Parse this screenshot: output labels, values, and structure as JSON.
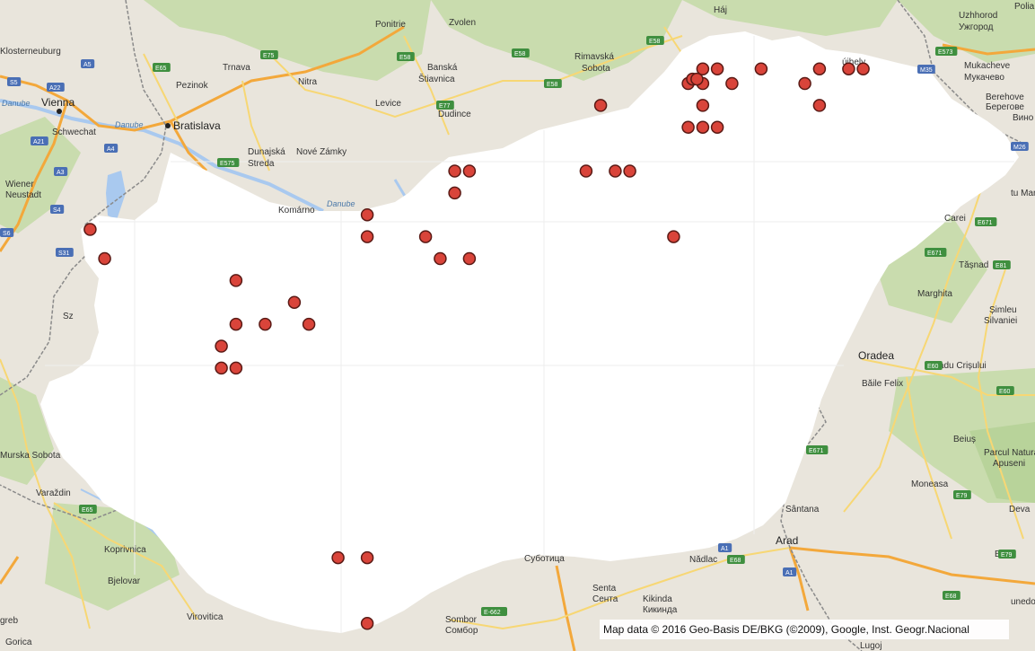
{
  "colors": {
    "land": "#e9e5dc",
    "forest": "#c9dcae",
    "water": "#a9c9ef",
    "border": "#8a8a8a",
    "motorway": "#f3a83b",
    "primary": "#f7d774",
    "highlight": "#ffffff",
    "marker_fill": "#d9443a",
    "marker_stroke": "#5a1a15"
  },
  "places": [
    {
      "id": "vienna",
      "label": "Vienna"
    },
    {
      "id": "bratislava",
      "label": "Bratislava"
    },
    {
      "id": "uzhhorod",
      "label": "Uzhhorod"
    },
    {
      "id": "uzhhorod_cyr",
      "label": "Ужгород"
    },
    {
      "id": "mukacheve",
      "label": "Mukacheve"
    },
    {
      "id": "mukacheve_cyr",
      "label": "Мукачево"
    },
    {
      "id": "oradea",
      "label": "Oradea"
    },
    {
      "id": "arad",
      "label": "Arad"
    },
    {
      "id": "kosice_area",
      "label": "Háj"
    },
    {
      "id": "zvolen",
      "label": "Zvolen"
    },
    {
      "id": "trnava",
      "label": "Trnava"
    },
    {
      "id": "nitra",
      "label": "Nitra"
    },
    {
      "id": "levice",
      "label": "Levice"
    },
    {
      "id": "pezinok",
      "label": "Pezinok"
    },
    {
      "id": "dunajska",
      "label": "Dunajská"
    },
    {
      "id": "streda",
      "label": "Streda"
    },
    {
      "id": "novezamky",
      "label": "Nové Zámky"
    },
    {
      "id": "banska",
      "label": "Banská"
    },
    {
      "id": "stiavnica",
      "label": "Štiavnica"
    },
    {
      "id": "rimavska",
      "label": "Rimavská"
    },
    {
      "id": "sobota",
      "label": "Sobota"
    },
    {
      "id": "schwechat",
      "label": "Schwechat"
    },
    {
      "id": "wiener",
      "label": "Wiener"
    },
    {
      "id": "neustadt",
      "label": "Neustadt"
    },
    {
      "id": "korneuburg",
      "label": "Klosterneuburg"
    },
    {
      "id": "varazdin",
      "label": "Varaždin"
    },
    {
      "id": "koprivnica",
      "label": "Koprivnica"
    },
    {
      "id": "bjelovar",
      "label": "Bjelovar"
    },
    {
      "id": "virovitica",
      "label": "Virovitica"
    },
    {
      "id": "murska",
      "label": "Murska Sobota"
    },
    {
      "id": "sombor",
      "label": "Sombor"
    },
    {
      "id": "sombor_cyr",
      "label": "Сомбор"
    },
    {
      "id": "subotica",
      "label": "Суботица"
    },
    {
      "id": "senta",
      "label": "Senta"
    },
    {
      "id": "senta_cyr",
      "label": "Сента"
    },
    {
      "id": "kikinda",
      "label": "Kikinda"
    },
    {
      "id": "kikinda_cyr",
      "label": "Кикинда"
    },
    {
      "id": "nadlac",
      "label": "Nădlac"
    },
    {
      "id": "santana",
      "label": "Sântana"
    },
    {
      "id": "moneasa",
      "label": "Moneasa"
    },
    {
      "id": "beius",
      "label": "Beiuș"
    },
    {
      "id": "parcul",
      "label": "Parcul Natural"
    },
    {
      "id": "apuseni",
      "label": "Apuseni"
    },
    {
      "id": "bailefelix",
      "label": "Băile Felix"
    },
    {
      "id": "vadu",
      "label": "Vadu Crișului"
    },
    {
      "id": "marghita",
      "label": "Marghita"
    },
    {
      "id": "simleu",
      "label": "Șimleu"
    },
    {
      "id": "silvaniei",
      "label": "Silvaniei"
    },
    {
      "id": "tasnad",
      "label": "Tășnad"
    },
    {
      "id": "carei",
      "label": "Carei"
    },
    {
      "id": "satu",
      "label": "tu Mar"
    },
    {
      "id": "berehove",
      "label": "Berehove"
    },
    {
      "id": "berehove_cyr",
      "label": "Берегове"
    },
    {
      "id": "vyno",
      "label": "Вино"
    },
    {
      "id": "poles",
      "label": "Polia"
    },
    {
      "id": "brad",
      "label": "Brad"
    },
    {
      "id": "deva",
      "label": "Deva"
    },
    {
      "id": "lugoj",
      "label": "Lugoj"
    },
    {
      "id": "hunedo",
      "label": "unedo"
    },
    {
      "id": "sujhely",
      "label": "újhely"
    },
    {
      "id": "dudince",
      "label": "Dudince"
    },
    {
      "id": "ponitrie",
      "label": "Ponitrie"
    },
    {
      "id": "komarno",
      "label": "Komárno"
    },
    {
      "id": "zagreb",
      "label": "greb"
    },
    {
      "id": "gorica",
      "label": "Gorica"
    },
    {
      "id": "zi",
      "label": "Sz"
    }
  ],
  "water_labels": [
    {
      "id": "danube_vienna",
      "label": "Danube"
    },
    {
      "id": "danube_brat",
      "label": "Danube"
    },
    {
      "id": "danube_komarno",
      "label": "Danube"
    }
  ],
  "road_shields": [
    {
      "id": "a5",
      "label": "A5"
    },
    {
      "id": "a22",
      "label": "A22"
    },
    {
      "id": "s5",
      "label": "S5"
    },
    {
      "id": "a21",
      "label": "A21"
    },
    {
      "id": "a4",
      "label": "A4"
    },
    {
      "id": "a3",
      "label": "A3"
    },
    {
      "id": "s4",
      "label": "S4"
    },
    {
      "id": "s6",
      "label": "S6"
    },
    {
      "id": "s31",
      "label": "S31"
    },
    {
      "id": "e65",
      "label": "E65"
    },
    {
      "id": "e75",
      "label": "E75"
    },
    {
      "id": "e58a",
      "label": "E58"
    },
    {
      "id": "e58b",
      "label": "E58"
    },
    {
      "id": "e58c",
      "label": "E58"
    },
    {
      "id": "e58d",
      "label": "E58"
    },
    {
      "id": "e77",
      "label": "E77"
    },
    {
      "id": "e575",
      "label": "E575"
    },
    {
      "id": "e573",
      "label": "E573"
    },
    {
      "id": "m26",
      "label": "M26"
    },
    {
      "id": "e671a",
      "label": "E671"
    },
    {
      "id": "e671b",
      "label": "E671"
    },
    {
      "id": "e671c",
      "label": "E671"
    },
    {
      "id": "e81",
      "label": "E81"
    },
    {
      "id": "e60a",
      "label": "E60"
    },
    {
      "id": "e60b",
      "label": "E60"
    },
    {
      "id": "e79a",
      "label": "E79"
    },
    {
      "id": "e79b",
      "label": "E79"
    },
    {
      "id": "e68a",
      "label": "E68"
    },
    {
      "id": "e68b",
      "label": "E68"
    },
    {
      "id": "a1a",
      "label": "A1"
    },
    {
      "id": "a1b",
      "label": "A1"
    },
    {
      "id": "e662",
      "label": "E-662"
    },
    {
      "id": "e65b",
      "label": "E65"
    },
    {
      "id": "m35",
      "label": "M35"
    }
  ],
  "markers": [
    {
      "lat": 48.35,
      "lon": 20.65
    },
    {
      "lat": 48.35,
      "lon": 20.75
    },
    {
      "lat": 48.35,
      "lon": 21.05
    },
    {
      "lat": 48.35,
      "lon": 21.45
    },
    {
      "lat": 48.35,
      "lon": 21.65
    },
    {
      "lat": 48.35,
      "lon": 21.75
    },
    {
      "lat": 48.25,
      "lon": 20.55
    },
    {
      "lat": 48.25,
      "lon": 20.65
    },
    {
      "lat": 48.25,
      "lon": 20.85
    },
    {
      "lat": 48.25,
      "lon": 21.35
    },
    {
      "lat": 48.28,
      "lon": 20.58
    },
    {
      "lat": 48.28,
      "lon": 20.61
    },
    {
      "lat": 48.1,
      "lon": 20.65
    },
    {
      "lat": 48.1,
      "lon": 21.45
    },
    {
      "lat": 48.1,
      "lon": 19.95
    },
    {
      "lat": 47.95,
      "lon": 20.55
    },
    {
      "lat": 47.95,
      "lon": 20.65
    },
    {
      "lat": 47.95,
      "lon": 20.75
    },
    {
      "lat": 47.65,
      "lon": 18.95
    },
    {
      "lat": 47.65,
      "lon": 19.05
    },
    {
      "lat": 47.65,
      "lon": 19.85
    },
    {
      "lat": 47.65,
      "lon": 20.05
    },
    {
      "lat": 47.65,
      "lon": 20.15
    },
    {
      "lat": 47.5,
      "lon": 18.95
    },
    {
      "lat": 47.35,
      "lon": 18.35
    },
    {
      "lat": 47.2,
      "lon": 18.35
    },
    {
      "lat": 47.2,
      "lon": 18.75
    },
    {
      "lat": 47.05,
      "lon": 18.85
    },
    {
      "lat": 47.05,
      "lon": 19.05
    },
    {
      "lat": 47.2,
      "lon": 20.45
    },
    {
      "lat": 47.25,
      "lon": 16.45
    },
    {
      "lat": 47.05,
      "lon": 16.55
    },
    {
      "lat": 46.9,
      "lon": 17.45
    },
    {
      "lat": 46.75,
      "lon": 17.85
    },
    {
      "lat": 46.6,
      "lon": 17.45
    },
    {
      "lat": 46.6,
      "lon": 17.65
    },
    {
      "lat": 46.6,
      "lon": 17.95
    },
    {
      "lat": 46.45,
      "lon": 17.35
    },
    {
      "lat": 46.3,
      "lon": 17.35
    },
    {
      "lat": 46.3,
      "lon": 17.45
    },
    {
      "lat": 45.0,
      "lon": 18.15
    },
    {
      "lat": 45.0,
      "lon": 18.35
    },
    {
      "lat": 44.55,
      "lon": 18.35
    }
  ],
  "attribution": "Map data © 2016 Geo-Basis DE/BKG (©2009), Google, Inst. Geogr.Nacional"
}
